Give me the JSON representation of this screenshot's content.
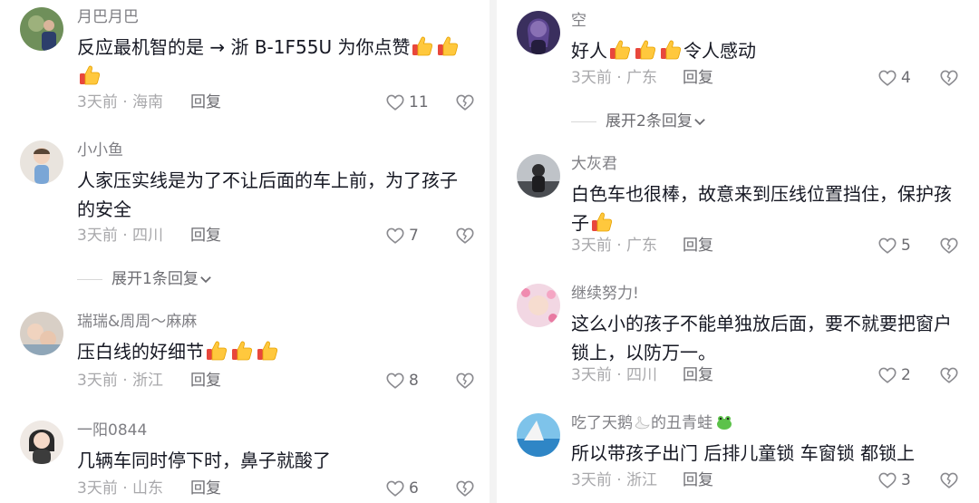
{
  "left": {
    "c1": {
      "username": "月巴月巴",
      "text": "反应最机智的是 → 浙 B-1F55U 为你点赞",
      "meta": "3天前 · 海南",
      "reply": "回复",
      "likes": "11"
    },
    "c2": {
      "username": "小小鱼",
      "text": "人家压实线是为了不让后面的车上前，为了孩子的安全",
      "meta": "3天前 · 四川",
      "reply": "回复",
      "likes": "7",
      "expand": "展开1条回复"
    },
    "c3": {
      "username": "瑞瑞&周周～麻麻",
      "text": "压白线的好细节",
      "meta": "3天前 · 浙江",
      "reply": "回复",
      "likes": "8"
    },
    "c4": {
      "username": "一阳0844",
      "text": "几辆车同时停下时，鼻子就酸了",
      "meta": "3天前 · 山东",
      "reply": "回复",
      "likes": "6"
    }
  },
  "right": {
    "c1": {
      "username": "空",
      "text": "好人",
      "text_after": "令人感动",
      "meta": "3天前 · 广东",
      "reply": "回复",
      "likes": "4",
      "expand": "展开2条回复"
    },
    "c2": {
      "username": "大灰君",
      "text": "白色车也很棒，故意来到压线位置挡住，保护孩子",
      "meta": "3天前 · 广东",
      "reply": "回复",
      "likes": "5"
    },
    "c3": {
      "username": "继续努力!",
      "text": "这么小的孩子不能单独放后面，要不就要把窗户锁上，以防万一。",
      "meta": "3天前 · 四川",
      "reply": "回复",
      "likes": "2"
    },
    "c4": {
      "username_a": "吃了天鹅",
      "username_b": "的丑青蛙",
      "text": "所以带孩子出门 后排儿童锁 车窗锁 都锁上",
      "meta": "3天前 · 浙江",
      "reply": "回复",
      "likes": "3"
    }
  },
  "icons": {
    "like": "heart-outline-icon",
    "dislike": "broken-heart-icon",
    "emoji": "thumbs-up-emoji",
    "expand": "chevron-down-icon"
  },
  "colors": {
    "text": "#161823",
    "username": "#7f7f84",
    "meta": "#a8a8ab",
    "action": "#6b6b70"
  }
}
